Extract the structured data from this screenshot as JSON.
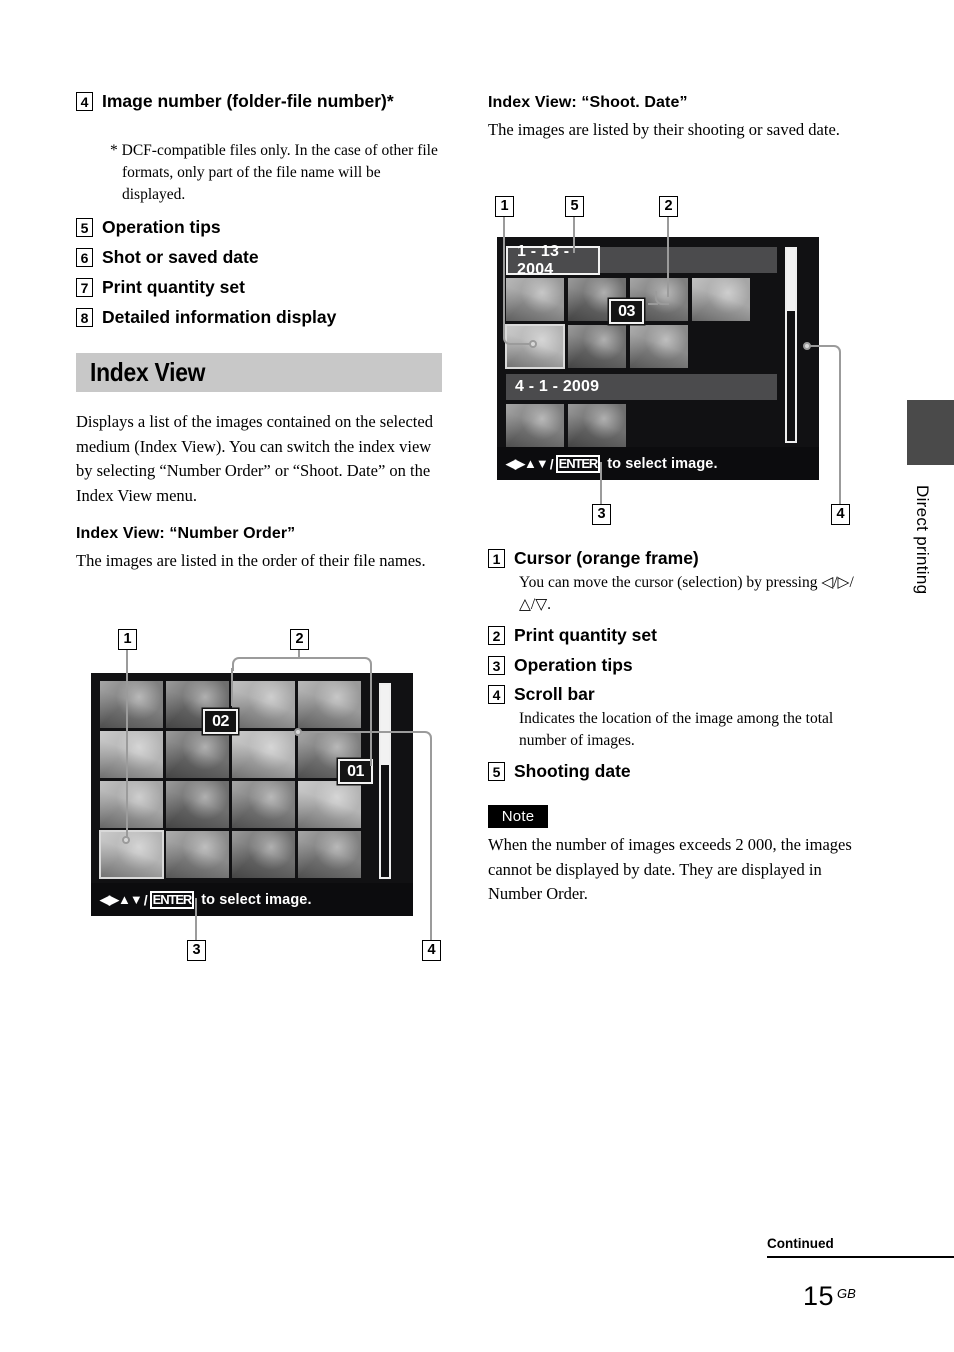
{
  "page": {
    "number": "15",
    "region_code": "GB",
    "continued_label": "Continued",
    "side_tab_label": "Direct printing"
  },
  "left_column": {
    "legend_items": [
      {
        "num": "4",
        "label": "Image number (folder-file number)*",
        "footnote": "* DCF-compatible files only. In the case of other file formats, only part of the file name will be displayed."
      },
      {
        "num": "5",
        "label": "Operation tips"
      },
      {
        "num": "6",
        "label": "Shot or saved date"
      },
      {
        "num": "7",
        "label": "Print quantity set"
      },
      {
        "num": "8",
        "label": "Detailed information display"
      }
    ],
    "section": {
      "title": "Index View",
      "intro": "Displays a list of the images contained on the selected medium (Index View). You can switch the index view by selecting “Number Order” or “Shoot. Date” on the Index View menu.",
      "subheading": "Index View: “Number Order”",
      "sub_intro": "The images are listed in the order of their file names."
    },
    "figure": {
      "callouts": [
        "1",
        "2",
        "3",
        "4"
      ],
      "badges": [
        "02",
        "01"
      ],
      "tips": {
        "arrows": "◀▶▲▼",
        "slash": "/",
        "enter": "ENTER",
        "text": "to select image."
      }
    }
  },
  "right_column": {
    "subheading": "Index View: “Shoot. Date”",
    "intro": "The images are listed by their shooting or saved date.",
    "figure": {
      "callouts": [
        "1",
        "5",
        "2",
        "3",
        "4"
      ],
      "dates": [
        "1 - 13 - 2004",
        "4 - 1 - 2009"
      ],
      "badges": [
        "03"
      ],
      "tips": {
        "arrows": "◀▶▲▼",
        "slash": "/",
        "enter": "ENTER",
        "text": "to select image."
      }
    },
    "legend_items": [
      {
        "num": "1",
        "label": "Cursor (orange frame)",
        "sub": "You can move the cursor (selection) by pressing ◁/▷/△/▽."
      },
      {
        "num": "2",
        "label": "Print quantity set"
      },
      {
        "num": "3",
        "label": "Operation tips"
      },
      {
        "num": "4",
        "label": "Scroll bar",
        "sub": "Indicates the location of the image among the total number of images."
      },
      {
        "num": "5",
        "label": "Shooting date"
      }
    ],
    "note": {
      "badge": "Note",
      "text": "When the number of images exceeds 2 000, the images cannot be displayed by date. They are displayed in Number Order."
    }
  }
}
